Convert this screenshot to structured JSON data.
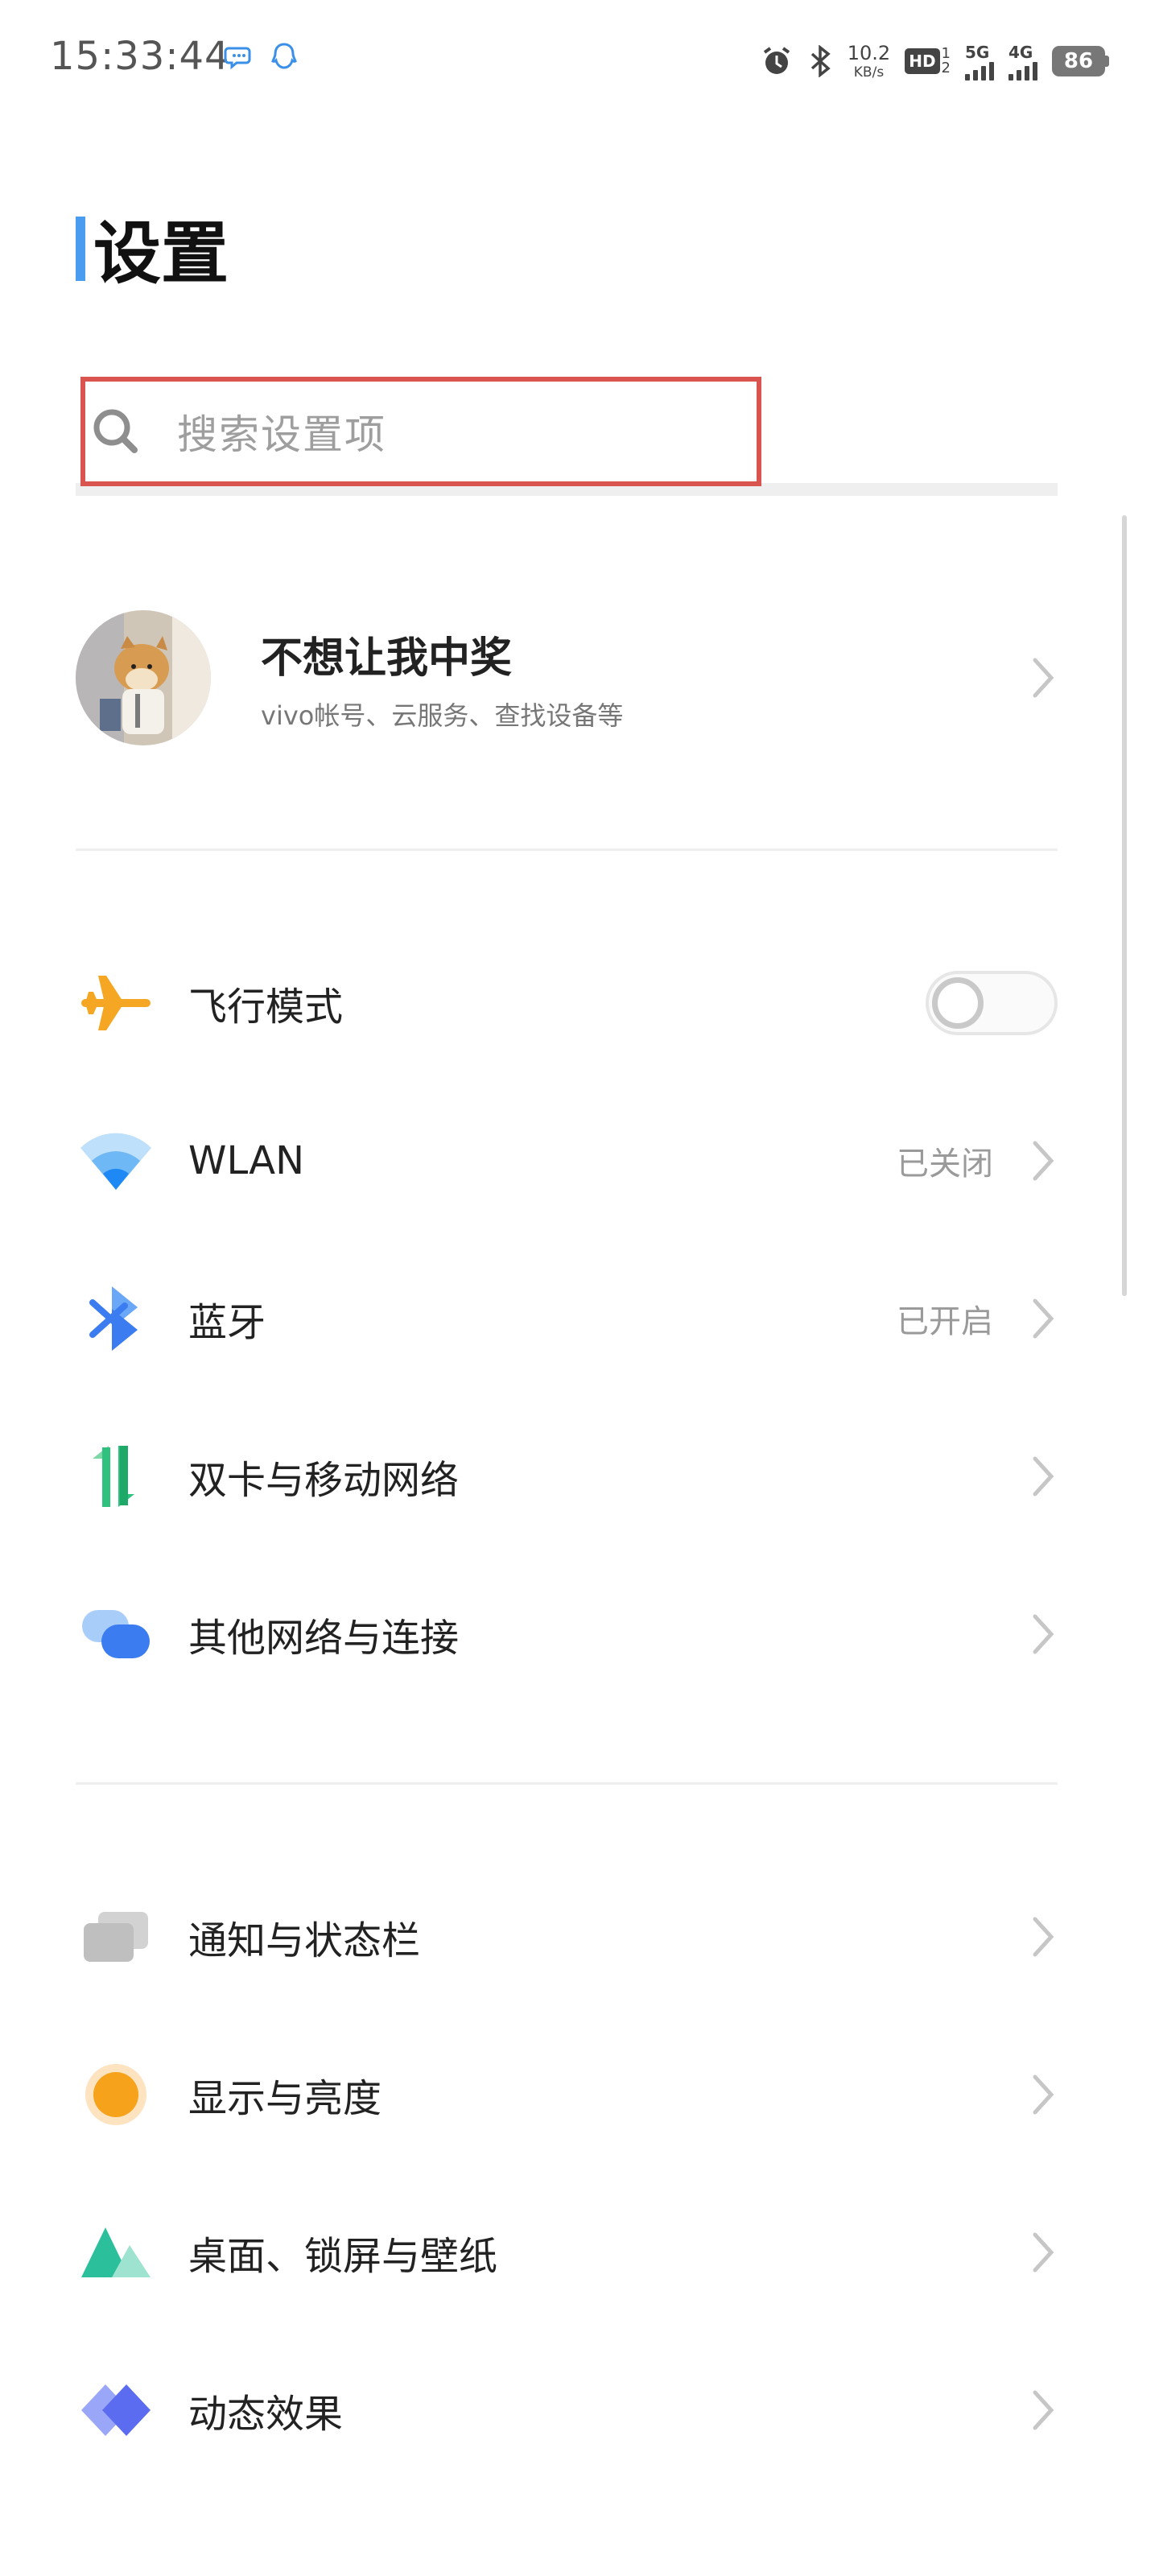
{
  "status_bar": {
    "time": "15:33:44",
    "net_speed_value": "10.2",
    "net_speed_unit": "KB/s",
    "hd_label": "HD",
    "hd_sub_top": "1",
    "hd_sub_bottom": "2",
    "sig1_label": "5G",
    "sig2_label": "4G",
    "battery": "86",
    "icons": [
      "message-bubble-icon",
      "qq-icon",
      "alarm-icon",
      "bluetooth-icon"
    ]
  },
  "header": {
    "title": "设置"
  },
  "search": {
    "placeholder": "搜索设置项"
  },
  "account": {
    "name": "不想让我中奖",
    "subtitle": "vivo帐号、云服务、查找设备等"
  },
  "groups": [
    {
      "items": [
        {
          "label": "飞行模式",
          "icon": "airplane-icon",
          "control": "toggle",
          "on": false
        },
        {
          "label": "WLAN",
          "icon": "wifi-icon",
          "status": "已关闭"
        },
        {
          "label": "蓝牙",
          "icon": "bluetooth-icon",
          "status": "已开启"
        },
        {
          "label": "双卡与移动网络",
          "icon": "dual-sim-icon"
        },
        {
          "label": "其他网络与连接",
          "icon": "other-network-icon"
        }
      ]
    },
    {
      "items": [
        {
          "label": "通知与状态栏",
          "icon": "notification-icon"
        },
        {
          "label": "显示与亮度",
          "icon": "display-brightness-icon"
        },
        {
          "label": "桌面、锁屏与壁纸",
          "icon": "wallpaper-icon"
        },
        {
          "label": "动态效果",
          "icon": "motion-effect-icon"
        }
      ]
    }
  ],
  "colors": {
    "accent": "#4a9cf0",
    "search_border": "#d9534f",
    "airplane": "#f5a623",
    "wifi": "#1e88f5",
    "bluetooth": "#3b7cf0",
    "dual_sim": "#2ec27e",
    "display": "#f7a21b",
    "wallpaper": "#2cbf9b",
    "motion": "#5b6cf0"
  }
}
